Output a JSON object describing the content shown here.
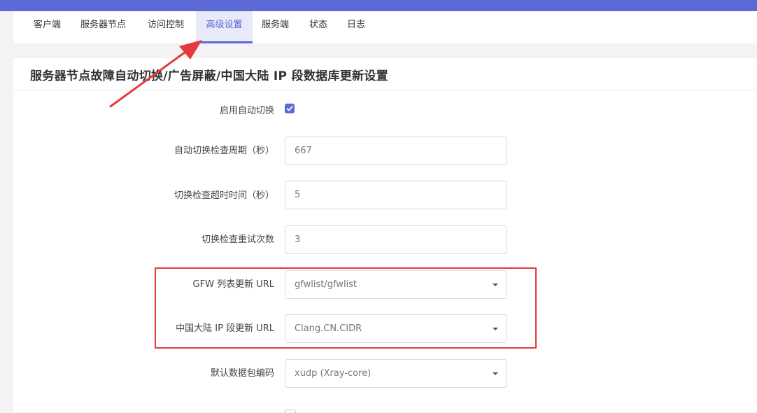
{
  "tabs": [
    {
      "label": "客户端"
    },
    {
      "label": "服务器节点"
    },
    {
      "label": "访问控制"
    },
    {
      "label": "高级设置",
      "active": true
    },
    {
      "label": "服务端"
    },
    {
      "label": "状态"
    },
    {
      "label": "日志"
    }
  ],
  "section": {
    "title": "服务器节点故障自动切换/广告屏蔽/中国大陆 IP 段数据库更新设置"
  },
  "form": {
    "auto_switch": {
      "label": "启用自动切换",
      "checked": true
    },
    "check_period": {
      "label": "自动切换检查周期（秒）",
      "value": "667"
    },
    "check_timeout": {
      "label": "切换检查超时时间（秒）",
      "value": "5"
    },
    "retry_count": {
      "label": "切换检查重试次数",
      "value": "3"
    },
    "gfw_list_url": {
      "label": "GFW 列表更新 URL",
      "value": "gfwlist/gfwlist"
    },
    "china_ip_url": {
      "label": "中国大陆 IP 段更新 URL",
      "value": "Clang.CN.CIDR"
    },
    "packet_encoding": {
      "label": "默认数据包编码",
      "value": "xudp (Xray-core)"
    }
  },
  "colors": {
    "accent": "#5b6ad6",
    "annotation": "#e33a3a"
  }
}
